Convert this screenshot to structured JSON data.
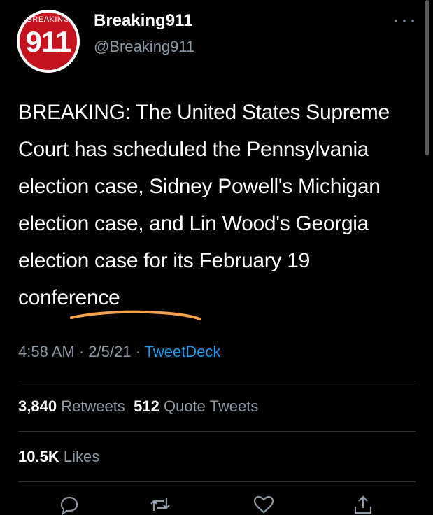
{
  "account": {
    "display_name": "Breaking911",
    "handle": "@Breaking911",
    "avatar_top_text": "BREAKING",
    "avatar_number": "911"
  },
  "tweet": {
    "text": "BREAKING: The United States Supreme Court has scheduled the Pennsylvania election case, Sidney Powell's Michigan election case, and Lin Wood's Georgia election case for its February 19 conference"
  },
  "meta": {
    "time": "4:58 AM",
    "sep1": " · ",
    "date": "2/5/21",
    "sep2": " · ",
    "source": "TweetDeck"
  },
  "stats": {
    "retweets_count": "3,840",
    "retweets_label": "Retweets",
    "quotes_count": "512",
    "quotes_label": "Quote Tweets",
    "likes_count": "10.5K",
    "likes_label": "Likes"
  },
  "colors": {
    "background": "#000000",
    "secondary_text": "#8b98a5",
    "link": "#1d9bf0",
    "divider": "#2f3336",
    "avatar_red": "#c4121f",
    "underline_annotation": "#f5a04b"
  },
  "icons": [
    "more-icon",
    "reply-icon",
    "retweet-icon",
    "like-icon",
    "share-icon"
  ]
}
